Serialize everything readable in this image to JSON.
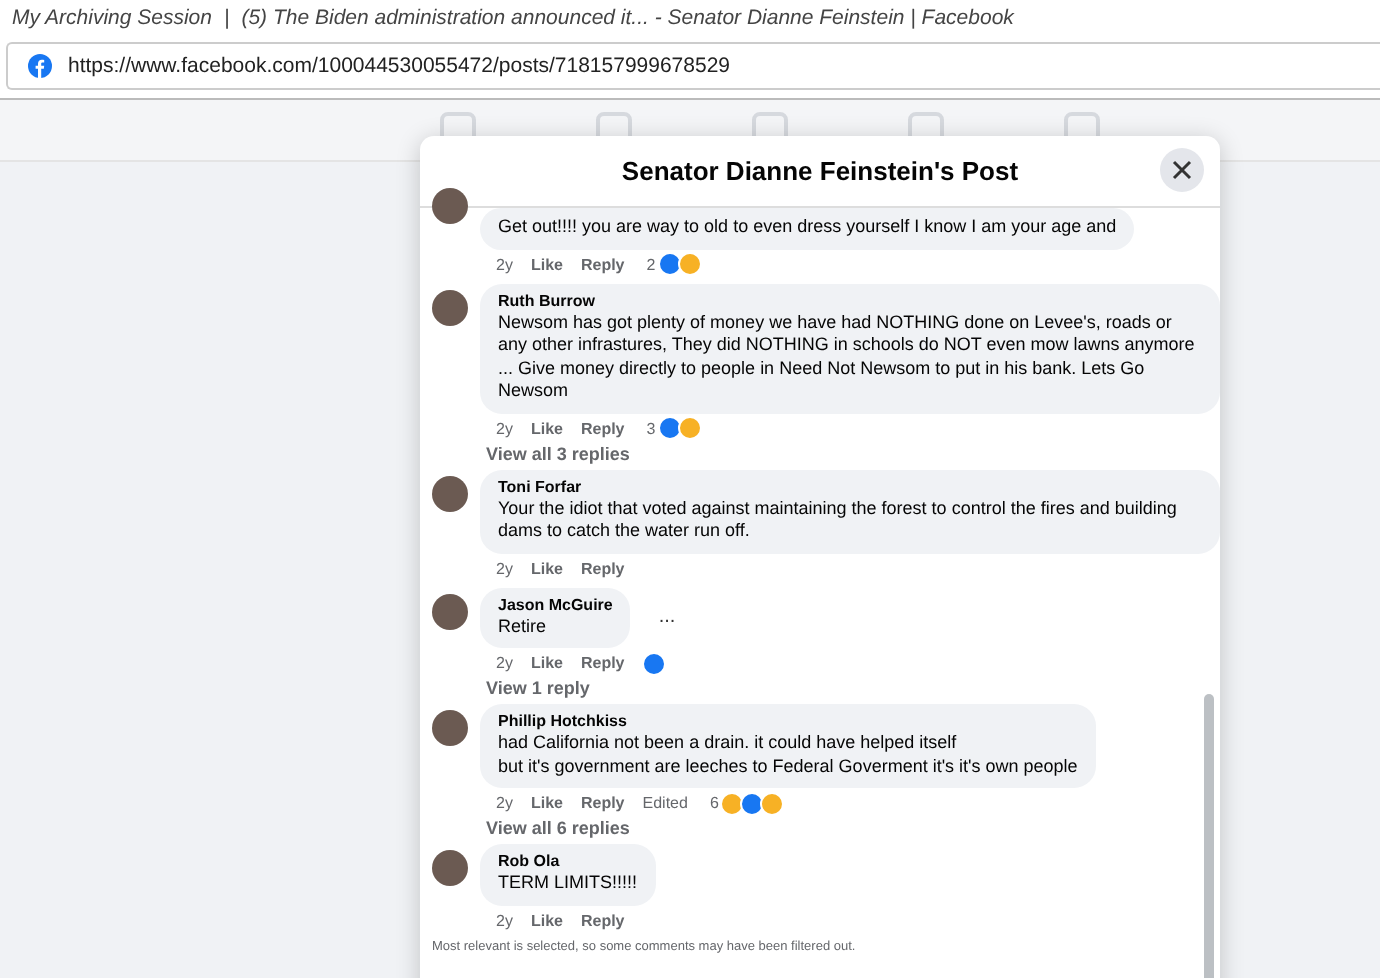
{
  "browser": {
    "session": "My Archiving Session",
    "separator": "|",
    "tab_title": "(5) The Biden administration announced it... - Senator Dianne Feinstein | Facebook",
    "url": "https://www.facebook.com/100044530055472/posts/718157999678529"
  },
  "dialog": {
    "title": "Senator Dianne Feinstein's Post"
  },
  "comments": [
    {
      "text": "Get out!!!! you are way to old to even dress yourself I know I am your age and",
      "time": "2y",
      "like": "Like",
      "reply": "Reply",
      "reaction_count": "2",
      "reactions": [
        {
          "kind": "like"
        },
        {
          "kind": "haha"
        }
      ]
    },
    {
      "author": "Ruth Burrow",
      "text": "Newsom has got plenty of money we have had NOTHING done on Levee's, roads or any other infrastures, They did NOTHING in schools do NOT even mow lawns anymore ... Give money directly to people in Need Not Newsom to put in his bank. Lets Go Newsom",
      "time": "2y",
      "like": "Like",
      "reply": "Reply",
      "reaction_count": "3",
      "reactions": [
        {
          "kind": "like"
        },
        {
          "kind": "haha"
        }
      ],
      "replies_link": "View all 3 replies"
    },
    {
      "author": "Toni Forfar",
      "text": "Your the idiot that voted against maintaining the forest to control the fires and building dams to catch the water run off.",
      "time": "2y",
      "like": "Like",
      "reply": "Reply"
    },
    {
      "author": "Jason McGuire",
      "text": "Retire",
      "time": "2y",
      "like": "Like",
      "reply": "Reply",
      "menu": "...",
      "reactions": [
        {
          "kind": "like"
        }
      ],
      "replies_link": "View 1 reply"
    },
    {
      "author": "Phillip Hotchkiss",
      "text": "had California not been a drain. it could have helped itself\nbut it's government are leeches to Federal Goverment it's it's own people",
      "time": "2y",
      "like": "Like",
      "reply": "Reply",
      "edited": "Edited",
      "reaction_count": "6",
      "reactions": [
        {
          "kind": "haha"
        },
        {
          "kind": "like"
        },
        {
          "kind": "wow"
        }
      ],
      "replies_link": "View all 6 replies"
    },
    {
      "author": "Rob Ola",
      "text": "TERM LIMITS!!!!!",
      "time": "2y",
      "like": "Like",
      "reply": "Reply"
    }
  ],
  "footer_note": "Most relevant is selected, so some comments may have been filtered out."
}
